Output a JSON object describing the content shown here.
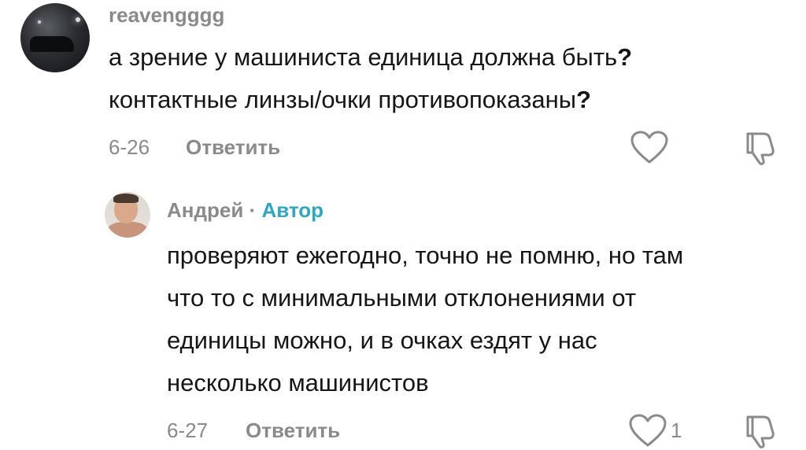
{
  "comments": [
    {
      "username": "reavengggg",
      "text_line1": "а зрение у машиниста единица должна быть",
      "text_line2": "контактные линзы/очки противопоказаны",
      "qmark": "?",
      "date": "6-26",
      "reply_label": "Ответить"
    }
  ],
  "reply": {
    "username": "Андрей",
    "separator": "·",
    "badge": "Автор",
    "lines": [
      "проверяют ежегодно, точно не помню, но там",
      "что то с минимальными отклонениями от",
      "единицы можно, и в очках ездят у нас",
      "несколько машинистов"
    ],
    "date": "6-27",
    "reply_label": "Ответить",
    "like_count": "1"
  },
  "icons": {
    "like": "heart-outline-icon",
    "dislike": "thumbs-down-icon"
  },
  "colors": {
    "author_accent": "#2aa8c6",
    "secondary_text": "#8a8a8a",
    "primary_text": "#161616"
  }
}
